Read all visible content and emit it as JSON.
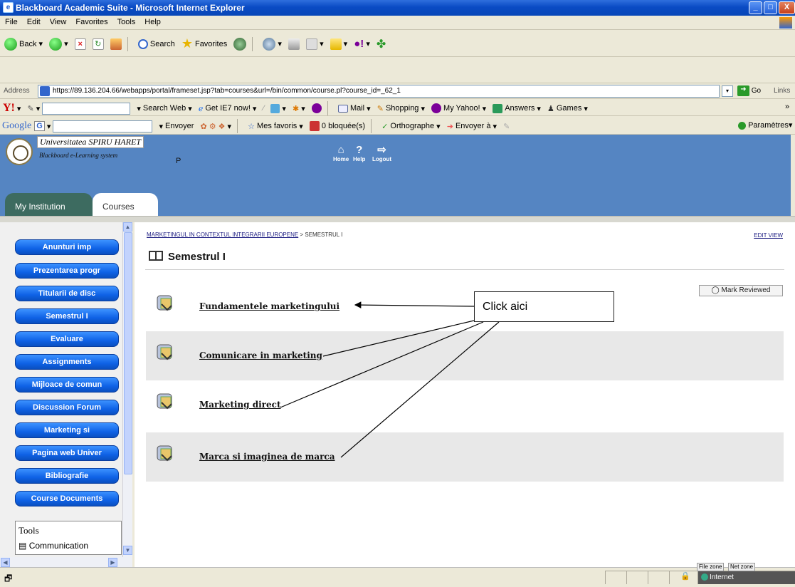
{
  "window": {
    "title": "Blackboard Academic Suite - Microsoft Internet Explorer",
    "controls": {
      "minimize": "_",
      "maximize": "□",
      "close": "X"
    }
  },
  "menu": [
    "File",
    "Edit",
    "View",
    "Favorites",
    "Tools",
    "Help"
  ],
  "toolbar": {
    "back": "Back",
    "search": "Search",
    "favorites": "Favorites"
  },
  "address": {
    "label": "Address",
    "url": "https://89.136.204.66/webapps/portal/frameset.jsp?tab=courses&url=/bin/common/course.pl?course_id=_62_1",
    "go": "Go",
    "links": "Links"
  },
  "yahoo_bar": {
    "search_web": "Search Web",
    "get_ie7": "Get IE7 now!",
    "mail": "Mail",
    "shopping": "Shopping",
    "my_yahoo": "My Yahoo!",
    "answers": "Answers",
    "games": "Games"
  },
  "google_bar": {
    "brand": "Google",
    "envoyer": "Envoyer",
    "mes_favoris": "Mes favoris",
    "bloquees": "0 bloquée(s)",
    "orthographe": "Orthographe",
    "envoyer_a": "Envoyer à",
    "parametres": "Paramètres"
  },
  "bb_header": {
    "institution": "Universitatea SPIRU HARET",
    "tagline": "Blackboard e-Learning system",
    "letter": "P",
    "nav": {
      "home": "Home",
      "help": "Help",
      "logout": "Logout"
    },
    "tabs": {
      "my_institution": "My Institution",
      "courses": "Courses"
    }
  },
  "course_menu": [
    "Anunturi imp",
    "Prezentarea progr",
    "Titularii de disc",
    "Semestrul I",
    "Evaluare",
    "Assignments",
    "Mijloace de comun",
    "Discussion Forum",
    "Marketing si",
    "Pagina web Univer",
    "Bibliografie",
    "Course Documents"
  ],
  "tools_panel": {
    "title": "Tools",
    "item": "Communication"
  },
  "main": {
    "breadcrumb_course": "MARKETINGUL IN CONTEXTUL INTEGRARII EUROPENE",
    "breadcrumb_sep": ">",
    "breadcrumb_current": "SEMESTRUL I",
    "edit_view": "EDIT VIEW",
    "title": "Semestrul I",
    "mark_reviewed": "Mark Reviewed",
    "items": [
      "Fundamentele marketingului",
      "Comunicare in marketing",
      "Marketing direct",
      "Marca si imaginea de marca"
    ],
    "callout": "Click aici"
  },
  "status_bar": {
    "file_zone": "File zone",
    "net_zone": "Net zone",
    "zone": "Internet"
  },
  "colors": {
    "title_bar": "#0a4bc4",
    "bb_header": "#5585c2",
    "course_button": "#1a6cf0",
    "my_institution_tab": "#3d6b60"
  },
  "icons": [
    "back-icon",
    "forward-icon",
    "stop-icon",
    "refresh-icon",
    "home-icon",
    "search-icon",
    "favorites-star-icon",
    "history-icon",
    "mail-icon",
    "print-icon",
    "folder-icon",
    "yahoo-icon",
    "messenger-icon",
    "go-arrow-icon",
    "book-icon",
    "lock-icon",
    "globe-icon"
  ]
}
